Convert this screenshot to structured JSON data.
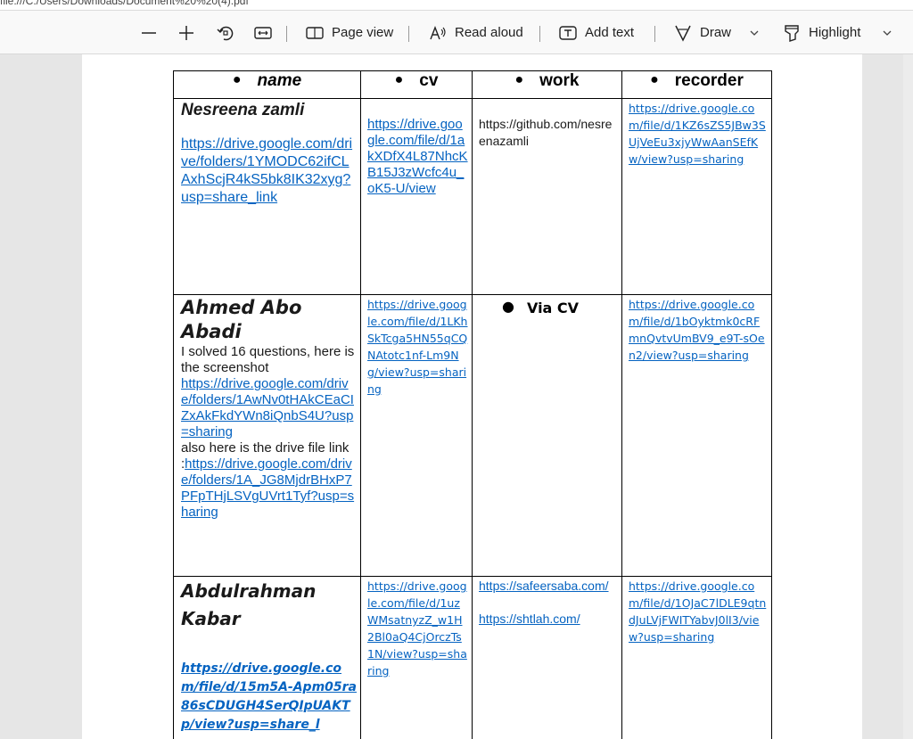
{
  "address_bar": {
    "text": "file:///C:/Users/Downloads/Document%20%20(4).pdf"
  },
  "toolbar": {
    "zoom_out_icon": "minus-icon",
    "zoom_in_icon": "plus-icon",
    "rotate_icon": "rotate-icon",
    "fit_icon": "fit-page-icon",
    "page_view_label": "Page view",
    "read_aloud_label": "Read aloud",
    "add_text_label": "Add text",
    "draw_label": "Draw",
    "highlight_label": "Highlight"
  },
  "table": {
    "headers": [
      "name",
      "cv",
      "work",
      "recorder"
    ],
    "rows": [
      {
        "name": "Nesreena zamli",
        "name_link": "https://drive.google.com/drive/folders/1YMODC62ifCLAxhScjR4kS5bk8IK32xyg?usp=share_link",
        "cv": "https://drive.google.com/file/d/1akXDfX4L87NhcKB15J3zWcfc4u_oK5-U/view",
        "work": "https://github.com/nesreenazamli",
        "recorder": "https://drive.google.com/file/d/1KZ6sZS5JBw3SUjVeEu3xjyWwAanSEfKw/view?usp=sharing"
      },
      {
        "name": "Ahmed Abo Abadi",
        "name_text1": "I solved 16 questions, here is the screenshot",
        "name_link1": "https://drive.google.com/drive/folders/1AwNv0tHAkCEaCIZxAkFkdYWn8iQnbS4U?usp=sharing",
        "name_text2": "also here is the drive file link",
        "name_link2_prefix": ":",
        "name_link2": "https://drive.google.com/drive/folders/1A_JG8MjdrBHxP7PFpTHjLSVgUVrt1Tyf?usp=sharing",
        "cv": "https://drive.google.com/file/d/1LKhSkTcga5HN55qCQNAtotc1nf-Lm9Ng/view?usp=sharing",
        "work": "Via CV",
        "recorder": "https://drive.google.com/file/d/1bOyktmk0cRFmnQvtvUmBV9_e9T-sOen2/view?usp=sharing"
      },
      {
        "name": "Abdulrahman Kabar",
        "name_link": "https://drive.google.com/file/d/15m5A-Apm05ra86sCDUGH4SerQIpUAKTp/view?usp=share_l",
        "cv": "https://drive.google.com/file/d/1uzWMsatnyzZ_w1H2Bl0aQ4CjOrczTs1N/view?usp=sharing",
        "work1": "https://safeersaba.com/",
        "work2": "https://shtlah.com/",
        "recorder": "https://drive.google.com/file/d/1OJaC7lDLE9qtndJuLVjFWITYabvJ0lI3/view?usp=sharing"
      }
    ]
  },
  "colors": {
    "link": "#0563c1",
    "toolbar_bg": "#f9f9f9",
    "page_bg": "#ffffff",
    "viewer_bg": "#e6e6e6"
  }
}
